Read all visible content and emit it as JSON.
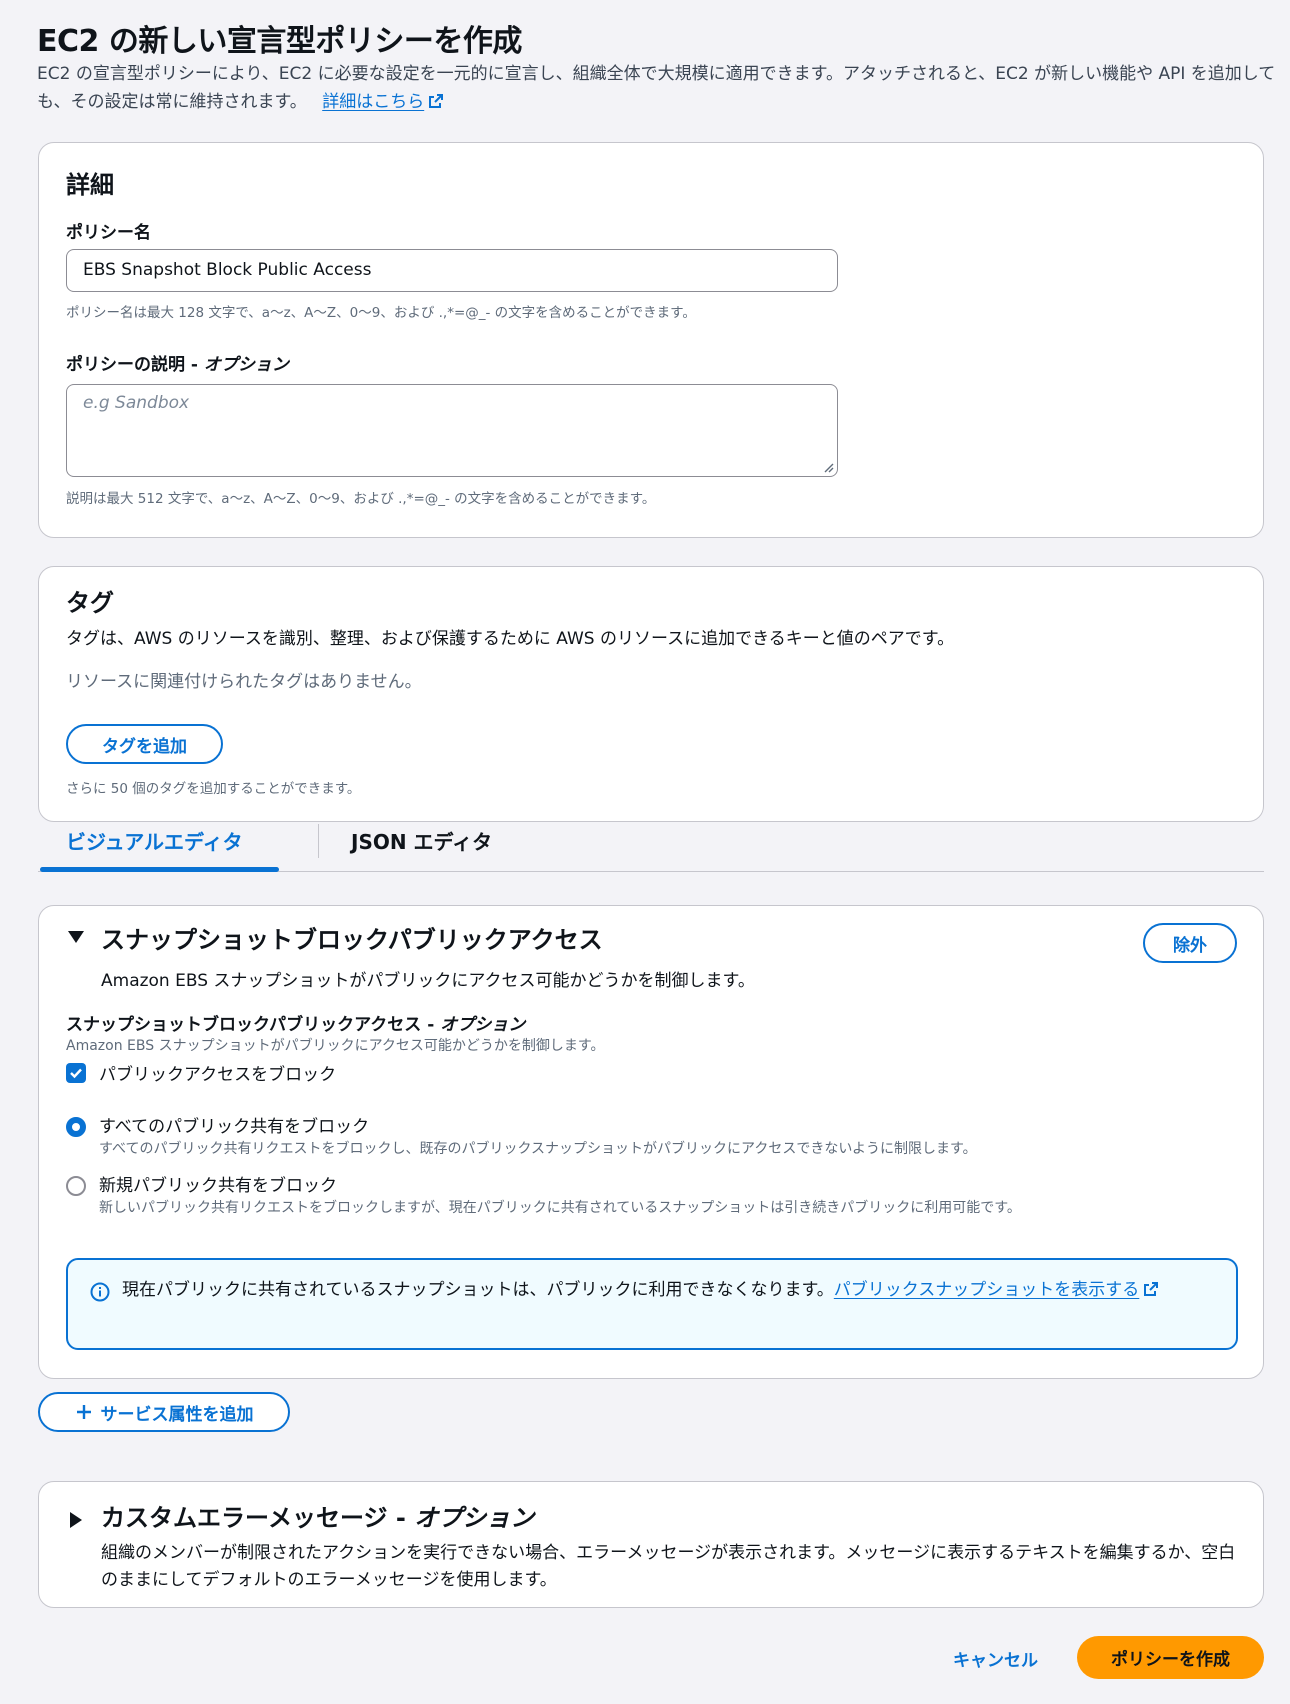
{
  "header": {
    "title": "EC2 の新しい宣言型ポリシーを作成",
    "description": "EC2 の宣言型ポリシーにより、EC2 に必要な設定を一元的に宣言し、組織全体で大規模に適用できます。アタッチされると、EC2 が新しい機能や API を追加しても、その設定は常に維持されます。",
    "learn_more_link": "詳細はこちら"
  },
  "details": {
    "title": "詳細",
    "policy_name_label": "ポリシー名",
    "policy_name_value": "EBS Snapshot Block Public Access",
    "policy_name_hint": "ポリシー名は最大 128 文字で、a〜z、A〜Z、0〜9、および .,*=@_- の文字を含めることができます。",
    "description_label": "ポリシーの説明 - ",
    "description_label_optional": "オプション",
    "description_placeholder": "e.g Sandbox",
    "description_hint": "説明は最大 512 文字で、a〜z、A〜Z、0〜9、および .,*=@_- の文字を含めることができます。"
  },
  "tags": {
    "title": "タグ",
    "description": "タグは、AWS のリソースを識別、整理、および保護するために AWS のリソースに追加できるキーと値のペアです。",
    "empty_text": "リソースに関連付けられたタグはありません。",
    "add_button": "タグを追加",
    "limit_hint": "さらに 50 個のタグを追加することができます。"
  },
  "editor_tabs": {
    "visual": "ビジュアルエディタ",
    "json": "JSON エディタ",
    "active": "visual"
  },
  "snapshot_section": {
    "title": "スナップショットブロックパブリックアクセス",
    "description": "Amazon EBS スナップショットがパブリックにアクセス可能かどうかを制御します。",
    "remove_button": "除外",
    "field_label": "スナップショットブロックパブリックアクセス - ",
    "field_label_optional": "オプション",
    "field_description": "Amazon EBS スナップショットがパブリックにアクセス可能かどうかを制御します。",
    "checkbox_label": "パブリックアクセスをブロック",
    "checkbox_checked": true,
    "options": [
      {
        "label": "すべてのパブリック共有をブロック",
        "description": "すべてのパブリック共有リクエストをブロックし、既存のパブリックスナップショットがパブリックにアクセスできないように制限します。",
        "selected": true
      },
      {
        "label": "新規パブリック共有をブロック",
        "description": "新しいパブリック共有リクエストをブロックしますが、現在パブリックに共有されているスナップショットは引き続きパブリックに利用可能です。",
        "selected": false
      }
    ],
    "info_text": "現在パブリックに共有されているスナップショットは、パブリックに利用できなくなります。",
    "info_link": "パブリックスナップショットを表示する"
  },
  "add_service_attribute_button": "サービス属性を追加",
  "custom_error": {
    "title": "カスタムエラーメッセージ - ",
    "title_optional": "オプション",
    "description": "組織のメンバーが制限されたアクションを実行できない場合、エラーメッセージが表示されます。メッセージに表示するテキストを編集するか、空白のままにしてデフォルトのエラーメッセージを使用します。"
  },
  "footer": {
    "cancel": "キャンセル",
    "create": "ポリシーを作成"
  },
  "colors": {
    "accent": "#0972d3",
    "primary_button": "#ff9900",
    "info_background": "#f0fbff"
  }
}
